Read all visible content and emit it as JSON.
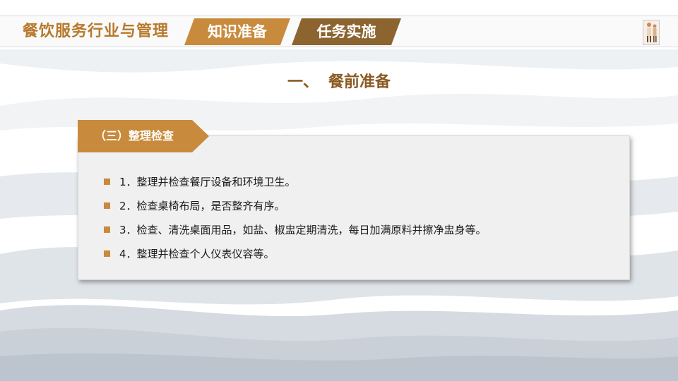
{
  "header": {
    "brand": "餐饮服务行业与管理",
    "tabs": [
      {
        "label": "知识准备"
      },
      {
        "label": "任务实施"
      }
    ]
  },
  "section": {
    "number": "一、",
    "title": "餐前准备"
  },
  "card": {
    "label": "（三）整理检查",
    "items": [
      {
        "text": "1．整理并检查餐厅设备和环境卫生。"
      },
      {
        "text": "2．检查桌椅布局，是否整齐有序。"
      },
      {
        "text": "3．检查、清洗桌面用品，如盐、椒盅定期清洗，每日加满原料并擦净盅身等。"
      },
      {
        "text": "4．整理并检查个人仪表仪容等。"
      }
    ]
  },
  "colors": {
    "accent": "#c88a3c",
    "accent_dark": "#8c6430",
    "title": "#8a5a22"
  },
  "icons": {
    "bullet": "square-bullet-icon",
    "corner": "figure-thumbnail-icon"
  }
}
